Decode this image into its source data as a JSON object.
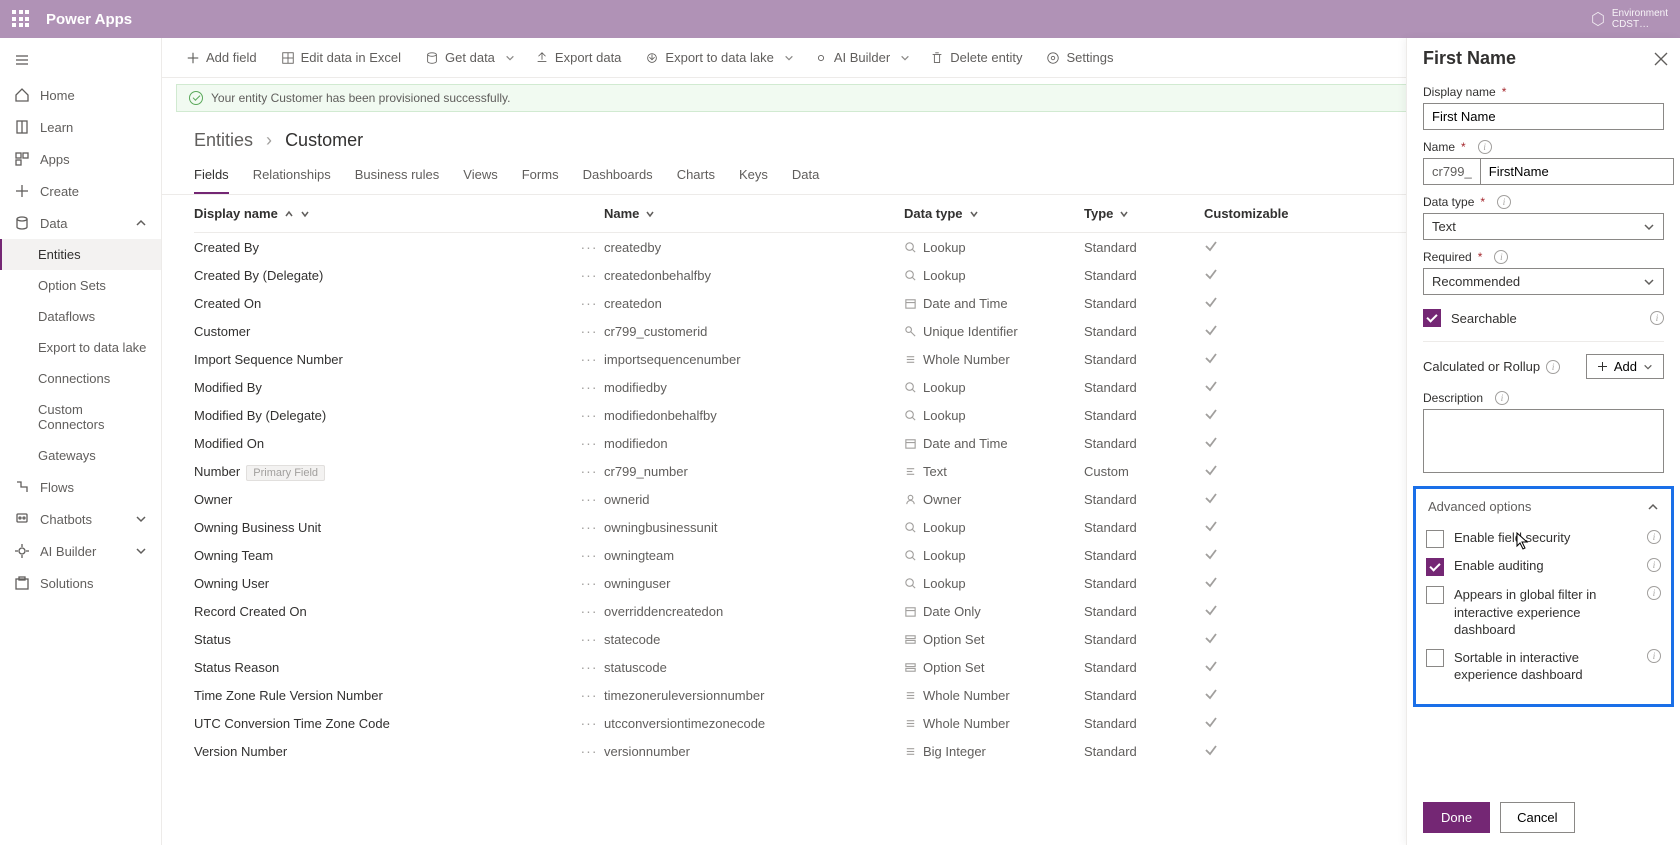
{
  "header": {
    "app": "Power Apps",
    "env_label": "Environment",
    "env_name": "CDST…"
  },
  "sidebar": {
    "home": "Home",
    "learn": "Learn",
    "apps": "Apps",
    "create": "Create",
    "data": "Data",
    "data_children": [
      "Entities",
      "Option Sets",
      "Dataflows",
      "Export to data lake",
      "Connections",
      "Custom Connectors",
      "Gateways"
    ],
    "flows": "Flows",
    "chatbots": "Chatbots",
    "ai": "AI Builder",
    "solutions": "Solutions"
  },
  "commands": {
    "add_field": "Add field",
    "edit_excel": "Edit data in Excel",
    "get_data": "Get data",
    "export_data": "Export data",
    "export_lake": "Export to data lake",
    "ai_builder": "AI Builder",
    "delete_entity": "Delete entity",
    "settings": "Settings"
  },
  "notification": "Your entity Customer has been provisioned successfully.",
  "breadcrumb": {
    "root": "Entities",
    "current": "Customer"
  },
  "tabs": [
    "Fields",
    "Relationships",
    "Business rules",
    "Views",
    "Forms",
    "Dashboards",
    "Charts",
    "Keys",
    "Data"
  ],
  "columns": {
    "display": "Display name",
    "name": "Name",
    "datatype": "Data type",
    "type": "Type",
    "cust": "Customizable"
  },
  "rows": [
    {
      "d": "Created By",
      "n": "createdby",
      "dt": "Lookup",
      "t": "Standard",
      "i": "lookup"
    },
    {
      "d": "Created By (Delegate)",
      "n": "createdonbehalfby",
      "dt": "Lookup",
      "t": "Standard",
      "i": "lookup"
    },
    {
      "d": "Created On",
      "n": "createdon",
      "dt": "Date and Time",
      "t": "Standard",
      "i": "date"
    },
    {
      "d": "Customer",
      "n": "cr799_customerid",
      "dt": "Unique Identifier",
      "t": "Standard",
      "i": "key"
    },
    {
      "d": "Import Sequence Number",
      "n": "importsequencenumber",
      "dt": "Whole Number",
      "t": "Standard",
      "i": "num"
    },
    {
      "d": "Modified By",
      "n": "modifiedby",
      "dt": "Lookup",
      "t": "Standard",
      "i": "lookup"
    },
    {
      "d": "Modified By (Delegate)",
      "n": "modifiedonbehalfby",
      "dt": "Lookup",
      "t": "Standard",
      "i": "lookup"
    },
    {
      "d": "Modified On",
      "n": "modifiedon",
      "dt": "Date and Time",
      "t": "Standard",
      "i": "date"
    },
    {
      "d": "Number",
      "n": "cr799_number",
      "dt": "Text",
      "t": "Custom",
      "i": "text",
      "primary": true
    },
    {
      "d": "Owner",
      "n": "ownerid",
      "dt": "Owner",
      "t": "Standard",
      "i": "owner"
    },
    {
      "d": "Owning Business Unit",
      "n": "owningbusinessunit",
      "dt": "Lookup",
      "t": "Standard",
      "i": "lookup"
    },
    {
      "d": "Owning Team",
      "n": "owningteam",
      "dt": "Lookup",
      "t": "Standard",
      "i": "lookup"
    },
    {
      "d": "Owning User",
      "n": "owninguser",
      "dt": "Lookup",
      "t": "Standard",
      "i": "lookup"
    },
    {
      "d": "Record Created On",
      "n": "overriddencreatedon",
      "dt": "Date Only",
      "t": "Standard",
      "i": "date"
    },
    {
      "d": "Status",
      "n": "statecode",
      "dt": "Option Set",
      "t": "Standard",
      "i": "opt"
    },
    {
      "d": "Status Reason",
      "n": "statuscode",
      "dt": "Option Set",
      "t": "Standard",
      "i": "opt"
    },
    {
      "d": "Time Zone Rule Version Number",
      "n": "timezoneruleversionnumber",
      "dt": "Whole Number",
      "t": "Standard",
      "i": "num"
    },
    {
      "d": "UTC Conversion Time Zone Code",
      "n": "utcconversiontimezonecode",
      "dt": "Whole Number",
      "t": "Standard",
      "i": "num"
    },
    {
      "d": "Version Number",
      "n": "versionnumber",
      "dt": "Big Integer",
      "t": "Standard",
      "i": "num"
    }
  ],
  "primary_badge": "Primary Field",
  "panel": {
    "title": "First Name",
    "display_label": "Display name",
    "display_value": "First Name",
    "name_label": "Name",
    "name_prefix": "cr799_",
    "name_value": "FirstName",
    "datatype_label": "Data type",
    "datatype_value": "Text",
    "required_label": "Required",
    "required_value": "Recommended",
    "searchable": "Searchable",
    "calc_label": "Calculated or Rollup",
    "add_btn": "Add",
    "desc_label": "Description",
    "adv_title": "Advanced options",
    "adv_field_sec": "Enable field security",
    "adv_audit": "Enable auditing",
    "adv_global": "Appears in global filter in interactive experience dashboard",
    "adv_sortable": "Sortable in interactive experience dashboard",
    "done": "Done",
    "cancel": "Cancel"
  }
}
